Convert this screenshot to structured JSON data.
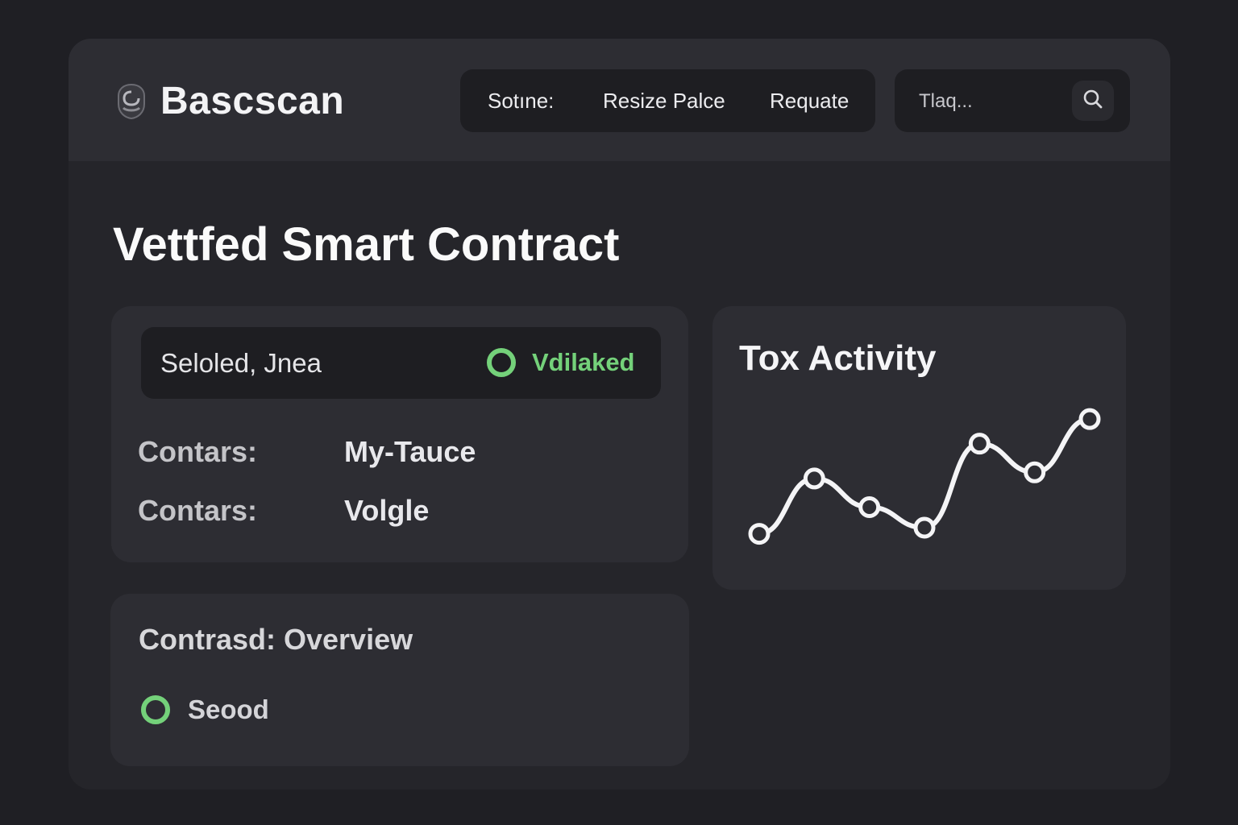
{
  "app": {
    "name": "Bascscan"
  },
  "nav": {
    "items": [
      {
        "label": "Sotıne:"
      },
      {
        "label": "Resize Palce"
      },
      {
        "label": "Requate"
      }
    ]
  },
  "search": {
    "placeholder": "Tlaq..."
  },
  "page": {
    "title": "Vettfed Smart Contract"
  },
  "details": {
    "status_label": "Seloled, Jnea",
    "verified_label": "Vdilaked",
    "rows": [
      {
        "label": "Contars:",
        "value": "My-Tauce"
      },
      {
        "label": "Contars:",
        "value": "Volgle"
      }
    ]
  },
  "overview": {
    "title": "Contrasd: Overview",
    "status_label": "Seood"
  },
  "activity": {
    "title": "Tox Activity"
  },
  "colors": {
    "background": "#1f1f24",
    "panel": "#2d2d33",
    "inset": "#1e1e22",
    "accent_green": "#74d17a",
    "text": "#f5f5f7"
  },
  "chart_data": {
    "type": "line",
    "title": "Tox Activity",
    "x": [
      1,
      2,
      3,
      4,
      5,
      6,
      7
    ],
    "series": [
      {
        "values": [
          1.0,
          3.7,
          2.3,
          1.3,
          5.4,
          4.0,
          6.6
        ]
      }
    ],
    "ylim": [
      0,
      7
    ],
    "grid": false
  }
}
